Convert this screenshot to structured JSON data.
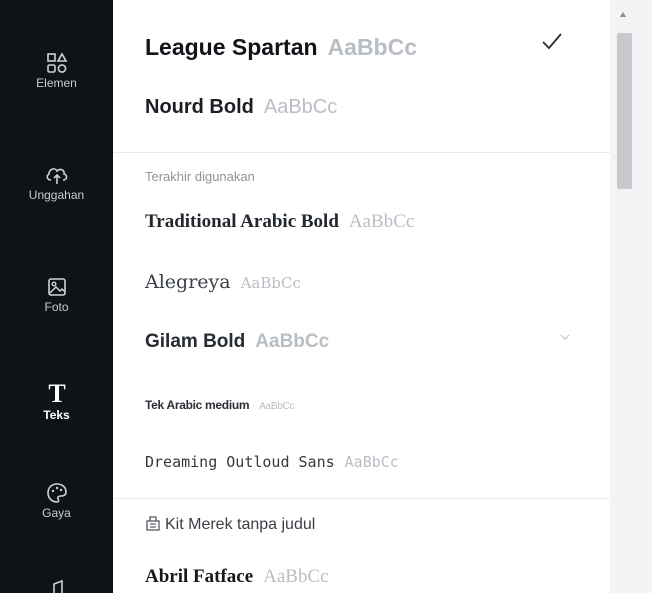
{
  "rail": {
    "items": [
      {
        "label": "Elemen",
        "icon": "shapes-icon"
      },
      {
        "label": "Unggahan",
        "icon": "cloud-upload-icon"
      },
      {
        "label": "Foto",
        "icon": "image-icon"
      },
      {
        "label": "Teks",
        "icon": "text-icon",
        "active": true
      },
      {
        "label": "Gaya",
        "icon": "palette-icon"
      }
    ]
  },
  "fonts": {
    "top": [
      {
        "name": "League Spartan",
        "sample": "AaBbCc",
        "selected": true
      },
      {
        "name": "Nourd Bold",
        "sample": "AaBbCc"
      }
    ],
    "recent_label": "Terakhir digunakan",
    "recent": [
      {
        "name": "Traditional Arabic Bold",
        "sample": "AaBbCc"
      },
      {
        "name": "Alegreya",
        "sample": "AaBbCc"
      },
      {
        "name": "Gilam Bold",
        "sample": "AaBbCc"
      },
      {
        "name": "Tek Arabic medium",
        "sample": "AaBbCc"
      },
      {
        "name": "Dreaming Outloud Sans",
        "sample": "AaBbCc"
      }
    ],
    "brand_kit_label": "Kit Merek tanpa judul",
    "brand": [
      {
        "name": "Abril Fatface",
        "sample": "AaBbCc"
      }
    ]
  },
  "colors": {
    "rail_bg": "#0e1318",
    "sample_gray": "#b9bec4",
    "text_dark": "#111418"
  }
}
